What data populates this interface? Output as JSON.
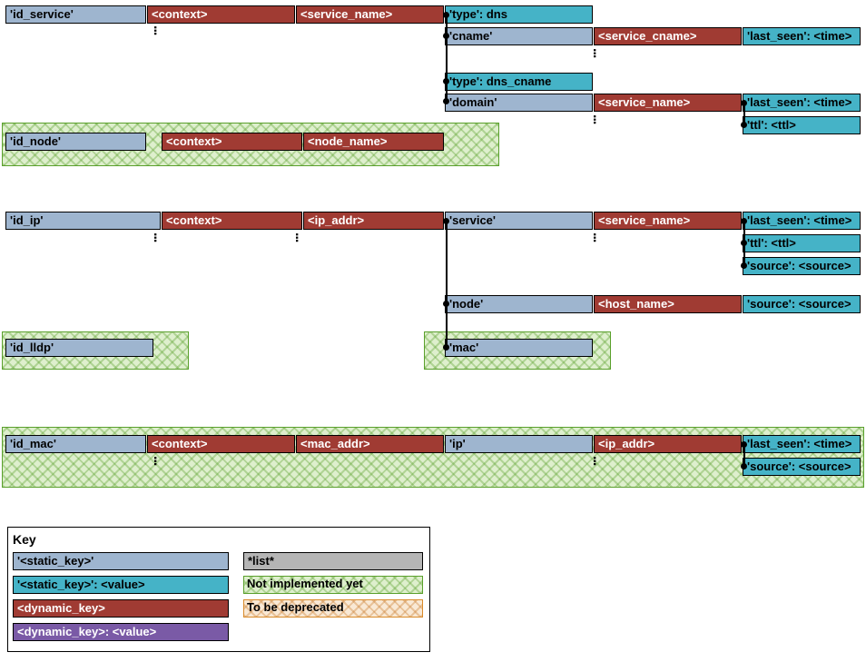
{
  "cells": {
    "id_service": "'id_service'",
    "context": "<context>",
    "service_name": "<service_name>",
    "type_dns": "'type': dns",
    "cname": "'cname'",
    "service_cname": "<service_cname>",
    "last_seen": "'last_seen': <time>",
    "type_dns_cname": "'type': dns_cname",
    "domain": "'domain'",
    "ttl": "'ttl': <ttl>",
    "id_node": "'id_node'",
    "node_name": "<node_name>",
    "id_ip": "'id_ip'",
    "ip_addr": "<ip_addr>",
    "service": "'service'",
    "source": "'source': <source>",
    "node": "'node'",
    "host_name": "<host_name>",
    "id_lldp": "'id_lldp'",
    "mac": "'mac'",
    "id_mac": "'id_mac'",
    "mac_addr": "<mac_addr>",
    "ip": "'ip'"
  },
  "legend": {
    "title": "Key",
    "static_key": "'<static_key>'",
    "static_key_val": "'<static_key>': <value>",
    "dynamic_key": "<dynamic_key>",
    "dynamic_key_val": "<dynamic_key>: <value>",
    "list": "*list*",
    "not_impl": "Not implemented yet",
    "deprecated": "To be deprecated"
  }
}
